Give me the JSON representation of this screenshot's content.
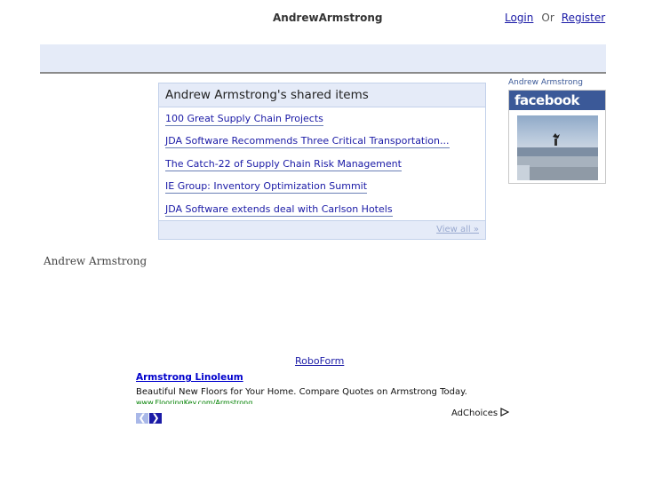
{
  "header": {
    "site_title": "AndrewArmstrong",
    "login_label": "Login",
    "or_label": "Or",
    "register_label": "Register"
  },
  "shared_items": {
    "title": "Andrew Armstrong's shared items",
    "items": [
      "100 Great Supply Chain Projects",
      "JDA Software Recommends Three Critical Transportation...",
      "The Catch-22 of Supply Chain Risk Management",
      "IE Group: Inventory Optimization Summit",
      "JDA Software extends deal with Carlson Hotels"
    ],
    "view_all_label": "View all »"
  },
  "facebook_badge": {
    "name": "Andrew Armstrong",
    "logo_text": "facebook",
    "brand_color": "#3b5998"
  },
  "byline": "Andrew Armstrong",
  "roboform_link": "RoboForm",
  "ad": {
    "title": "Armstrong Linoleum",
    "description": "Beautiful New Floors for Your Home. Compare Quotes on Armstrong Today.",
    "url": "www.FlooringKey.com/Armstrong",
    "prev_icon": "chevron-left-icon",
    "next_icon": "chevron-right-icon",
    "adchoices_label": "AdChoices"
  }
}
